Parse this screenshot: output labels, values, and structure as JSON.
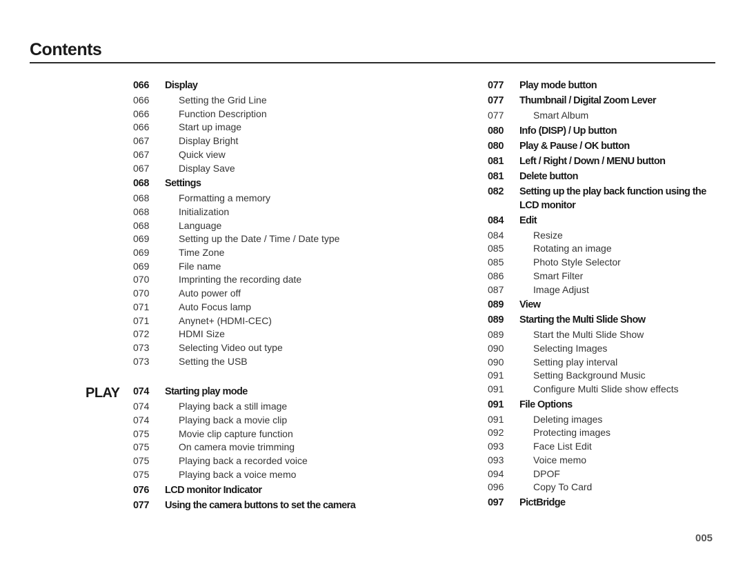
{
  "title": "Contents",
  "section_label": "PLAY",
  "page_number": "005",
  "left_column": [
    {
      "page": "066",
      "text": "Display",
      "level": "main"
    },
    {
      "page": "066",
      "text": "Setting the Grid Line",
      "level": "sub"
    },
    {
      "page": "066",
      "text": "Function Description",
      "level": "sub"
    },
    {
      "page": "066",
      "text": "Start up image",
      "level": "sub"
    },
    {
      "page": "067",
      "text": "Display Bright",
      "level": "sub"
    },
    {
      "page": "067",
      "text": "Quick view",
      "level": "sub"
    },
    {
      "page": "067",
      "text": "Display Save",
      "level": "sub"
    },
    {
      "page": "068",
      "text": "Settings",
      "level": "main"
    },
    {
      "page": "068",
      "text": "Formatting a memory",
      "level": "sub"
    },
    {
      "page": "068",
      "text": "Initialization",
      "level": "sub"
    },
    {
      "page": "068",
      "text": "Language",
      "level": "sub"
    },
    {
      "page": "069",
      "text": "Setting up the Date / Time / Date type",
      "level": "sub"
    },
    {
      "page": "069",
      "text": "Time Zone",
      "level": "sub"
    },
    {
      "page": "069",
      "text": "File name",
      "level": "sub"
    },
    {
      "page": "070",
      "text": "Imprinting the recording date",
      "level": "sub"
    },
    {
      "page": "070",
      "text": "Auto power off",
      "level": "sub"
    },
    {
      "page": "071",
      "text": "Auto Focus lamp",
      "level": "sub"
    },
    {
      "page": "071",
      "text": "Anynet+ (HDMI-CEC)",
      "level": "sub"
    },
    {
      "page": "072",
      "text": "HDMI Size",
      "level": "sub"
    },
    {
      "page": "073",
      "text": "Selecting Video out type",
      "level": "sub"
    },
    {
      "page": "073",
      "text": "Setting the USB",
      "level": "sub"
    },
    {
      "page": "074",
      "text": "Starting play mode",
      "level": "main",
      "gap": true
    },
    {
      "page": "074",
      "text": "Playing back a still image",
      "level": "sub"
    },
    {
      "page": "074",
      "text": "Playing back a movie clip",
      "level": "sub"
    },
    {
      "page": "075",
      "text": "Movie clip capture function",
      "level": "sub"
    },
    {
      "page": "075",
      "text": "On camera movie trimming",
      "level": "sub"
    },
    {
      "page": "075",
      "text": "Playing back a recorded voice",
      "level": "sub"
    },
    {
      "page": "075",
      "text": "Playing back a voice memo",
      "level": "sub"
    },
    {
      "page": "076",
      "text": "LCD monitor Indicator",
      "level": "main"
    },
    {
      "page": "077",
      "text": "Using the camera buttons to set the camera",
      "level": "main"
    }
  ],
  "right_column": [
    {
      "page": "077",
      "text": "Play mode button",
      "level": "main"
    },
    {
      "page": "077",
      "text": "Thumbnail / Digital Zoom  Lever",
      "level": "main"
    },
    {
      "page": "077",
      "text": "Smart Album",
      "level": "sub"
    },
    {
      "page": "080",
      "text": "Info (DISP) / Up button",
      "level": "main"
    },
    {
      "page": "080",
      "text": "Play & Pause / OK button",
      "level": "main"
    },
    {
      "page": "081",
      "text": "Left / Right / Down / MENU button",
      "level": "main"
    },
    {
      "page": "081",
      "text": "Delete button",
      "level": "main"
    },
    {
      "page": "082",
      "text": "Setting up the play back function using the LCD monitor",
      "level": "main"
    },
    {
      "page": "084",
      "text": "Edit",
      "level": "main"
    },
    {
      "page": "084",
      "text": "Resize",
      "level": "sub"
    },
    {
      "page": "085",
      "text": "Rotating an image",
      "level": "sub"
    },
    {
      "page": "085",
      "text": "Photo Style Selector",
      "level": "sub"
    },
    {
      "page": "086",
      "text": "Smart Filter",
      "level": "sub"
    },
    {
      "page": "087",
      "text": "Image Adjust",
      "level": "sub"
    },
    {
      "page": "089",
      "text": "View",
      "level": "main"
    },
    {
      "page": "089",
      "text": "Starting the Multi Slide Show",
      "level": "main"
    },
    {
      "page": "089",
      "text": "Start the Multi Slide Show",
      "level": "sub"
    },
    {
      "page": "090",
      "text": "Selecting Images",
      "level": "sub"
    },
    {
      "page": "090",
      "text": "Setting play interval",
      "level": "sub"
    },
    {
      "page": "091",
      "text": "Setting Background Music",
      "level": "sub"
    },
    {
      "page": "091",
      "text": "Configure Multi Slide show effects",
      "level": "sub"
    },
    {
      "page": "091",
      "text": "File Options",
      "level": "main"
    },
    {
      "page": "091",
      "text": "Deleting images",
      "level": "sub"
    },
    {
      "page": "092",
      "text": "Protecting images",
      "level": "sub"
    },
    {
      "page": "093",
      "text": "Face List Edit",
      "level": "sub"
    },
    {
      "page": "093",
      "text": "Voice memo",
      "level": "sub"
    },
    {
      "page": "094",
      "text": "DPOF",
      "level": "sub"
    },
    {
      "page": "096",
      "text": "Copy To Card",
      "level": "sub"
    },
    {
      "page": "097",
      "text": "PictBridge",
      "level": "main"
    }
  ]
}
